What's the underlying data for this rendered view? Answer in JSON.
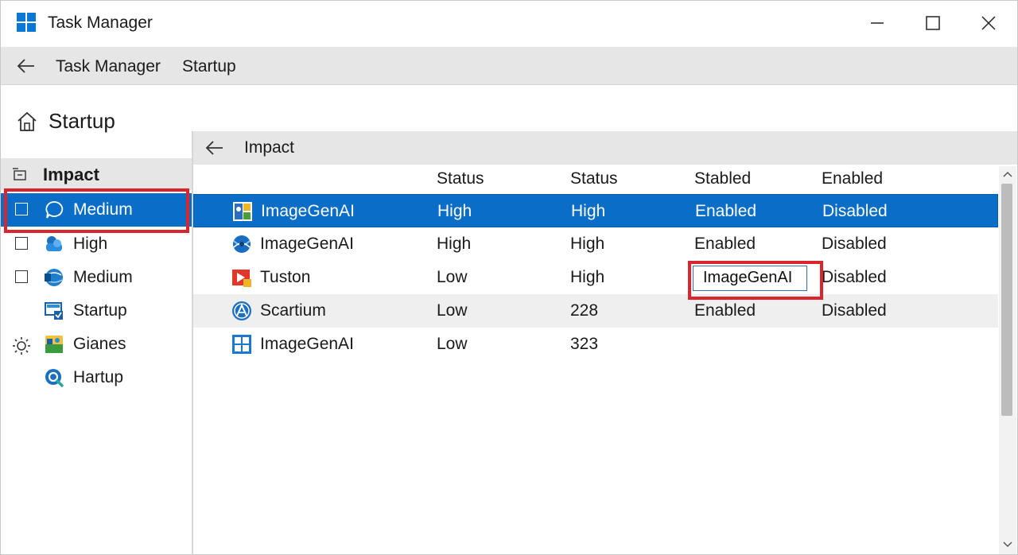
{
  "window": {
    "title": "Task Manager"
  },
  "breadcrumb": {
    "items": [
      "Task Manager",
      "Startup"
    ]
  },
  "nav": {
    "heading": "Startup",
    "section_label": "Impact",
    "items": [
      {
        "label": "Medium",
        "checkbox": true,
        "selected": true,
        "icon": "chat-bubble-icon"
      },
      {
        "label": "High",
        "checkbox": true,
        "selected": false,
        "icon": "cloud-app-icon"
      },
      {
        "label": "Medium",
        "checkbox": true,
        "selected": false,
        "icon": "globe-app-icon"
      },
      {
        "label": "Startup",
        "checkbox": false,
        "selected": false,
        "icon": "monitor-check-icon"
      },
      {
        "label": "Gianes",
        "checkbox": false,
        "selected": false,
        "icon": "photos-app-icon"
      },
      {
        "label": "Hartup",
        "checkbox": false,
        "selected": false,
        "icon": "search-app-icon"
      }
    ]
  },
  "pane": {
    "title": "Impact",
    "columns": [
      "",
      "Status",
      "Status",
      "Stabled",
      "Enabled"
    ]
  },
  "table": {
    "rows": [
      {
        "name": "ImageGenAI",
        "s1": "High",
        "s2": "High",
        "s3": "Enabled",
        "s4": "Disabled",
        "icon": "imagegen-app-icon",
        "selected": true
      },
      {
        "name": "ImageGenAI",
        "s1": "High",
        "s2": "High",
        "s3": "Enabled",
        "s4": "Disabled",
        "icon": "globe-blue-icon",
        "selected": false
      },
      {
        "name": "Tuston",
        "s1": "Low",
        "s2": "High",
        "s3": "",
        "s4": "Disabled",
        "icon": "play-app-icon",
        "selected": false
      },
      {
        "name": "Scartium",
        "s1": "Low",
        "s2": "228",
        "s3": "Enabled",
        "s4": "Disabled",
        "icon": "scartium-app-icon",
        "selected": false
      },
      {
        "name": "ImageGenAI",
        "s1": "Low",
        "s2": "323",
        "s3": "",
        "s4": "",
        "icon": "windows-logo-icon",
        "selected": false
      }
    ],
    "edit_value": "ImageGenAI"
  },
  "colors": {
    "selection": "#0a6ec8",
    "highlight": "#d9262e",
    "bar": "#e6e6e6"
  }
}
